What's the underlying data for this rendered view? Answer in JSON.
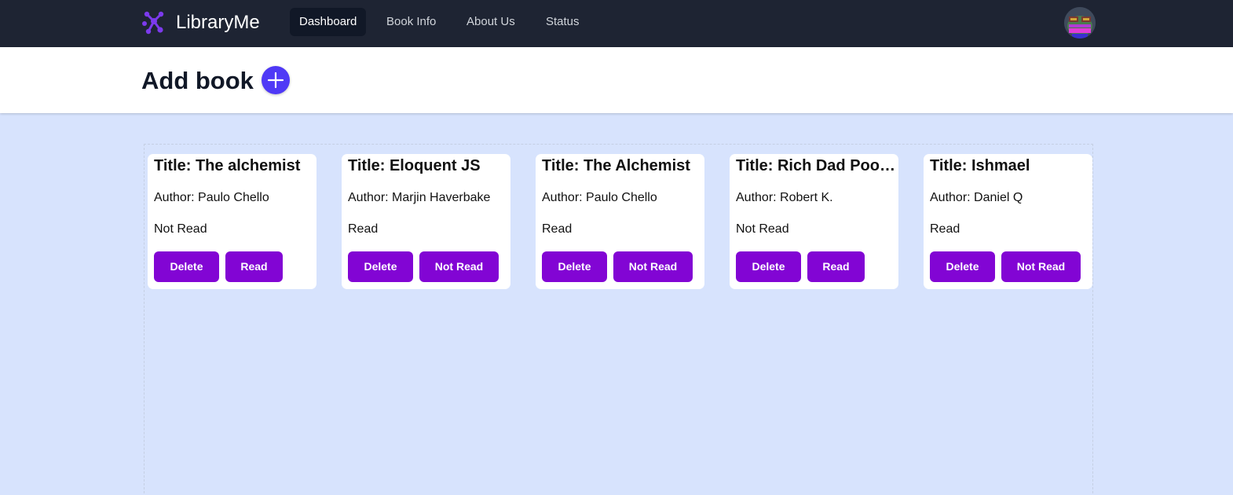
{
  "app": {
    "brand": "LibraryMe"
  },
  "nav": {
    "items": [
      {
        "label": "Dashboard",
        "active": true
      },
      {
        "label": "Book Info",
        "active": false
      },
      {
        "label": "About Us",
        "active": false
      },
      {
        "label": "Status",
        "active": false
      }
    ]
  },
  "header": {
    "title": "Add book",
    "add_icon": "plus-icon"
  },
  "colors": {
    "nav_bg": "#1e2433",
    "page_bg": "#d7e3fd",
    "accent": "#4f39f6",
    "button": "#8205d4",
    "logo": "#7c3aed"
  },
  "books": [
    {
      "title": "Title: The alchemist",
      "author": "Author: Paulo Chello",
      "status": "Not Read",
      "delete_label": "Delete",
      "toggle_label": "Read"
    },
    {
      "title": "Title: Eloquent JS",
      "author": "Author: Marjin Haverbake",
      "status": "Read",
      "delete_label": "Delete",
      "toggle_label": "Not Read"
    },
    {
      "title": "Title: The Alchemist",
      "author": "Author: Paulo Chello",
      "status": "Read",
      "delete_label": "Delete",
      "toggle_label": "Not Read"
    },
    {
      "title": "Title: Rich Dad Poor Dad",
      "author": "Author: Robert K.",
      "status": "Not Read",
      "delete_label": "Delete",
      "toggle_label": "Read"
    },
    {
      "title": "Title: Ishmael",
      "author": "Author: Daniel Q",
      "status": "Read",
      "delete_label": "Delete",
      "toggle_label": "Not Read"
    }
  ]
}
